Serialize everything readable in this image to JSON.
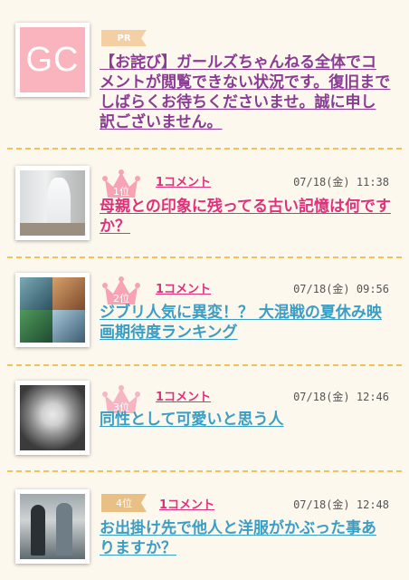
{
  "pr_item": {
    "thumb_text": "GC",
    "tag": "PR",
    "title": "【お詫び】ガールズちゃんねる全体でコメントが閲覧できない状況です。復旧までしばらくお待ちくださいませ。誠に申し訳ございません。"
  },
  "ranking": [
    {
      "rank": "1位",
      "comments": "1コメント",
      "date": "07/18(金) 11:38",
      "title": "母親との印象に残ってる古い記憶は何ですか？",
      "crown_color": "#f7a3b5"
    },
    {
      "rank": "2位",
      "comments": "1コメント",
      "date": "07/18(金) 09:56",
      "title": "ジブリ人気に異変！？ 大混戦の夏休み映画期待度ランキング",
      "crown_color": "#f7a3b5"
    },
    {
      "rank": "3位",
      "comments": "1コメント",
      "date": "07/18(金) 12:46",
      "title": "同性として可愛いと思う人",
      "crown_color": "#f7b4c2"
    },
    {
      "rank": "4位",
      "comments": "1コメント",
      "date": "07/18(金) 12:48",
      "title": "お出掛け先で他人と洋服がかぶった事ありますか？"
    }
  ],
  "colors": {
    "background": "#fdf8ee",
    "divider": "#f4c05a",
    "pr_title": "#8a3b93",
    "rank_title": "#e0307a",
    "link_title": "#3a9dc4"
  }
}
